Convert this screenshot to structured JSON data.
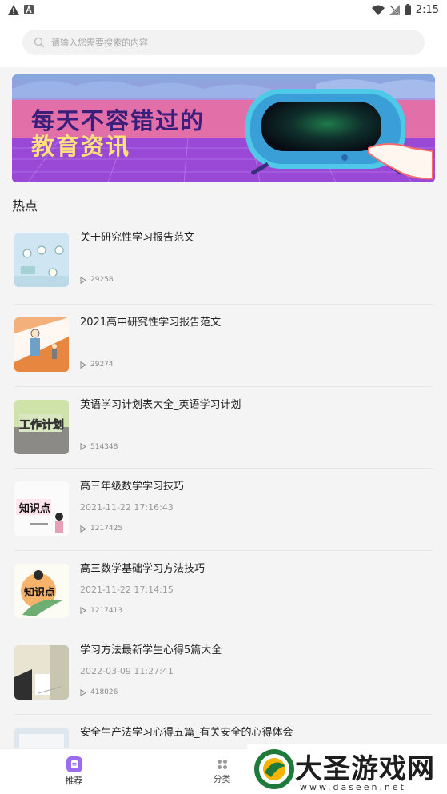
{
  "status_bar": {
    "time": "2:15",
    "left_icons": [
      "warning-icon",
      "a-icon"
    ],
    "right_icons": [
      "wifi-icon",
      "no-signal-icon",
      "battery-icon"
    ]
  },
  "search": {
    "placeholder": "请输入您需要搜索的内容"
  },
  "banner": {
    "line1": "每天不容错过的",
    "line2": "教育资讯",
    "colors": {
      "sky": "#7ea6dc",
      "floor": "#9f4fd8",
      "pink": "#e96fa8",
      "screen": "#4cc7e6"
    }
  },
  "section": {
    "title": "热点"
  },
  "articles": [
    {
      "title": "关于研究性学习报告范文",
      "date": "",
      "views": "29258"
    },
    {
      "title": "2021高中研究性学习报告范文",
      "date": "",
      "views": "29274"
    },
    {
      "title": "英语学习计划表大全_英语学习计划",
      "date": "",
      "views": "514348"
    },
    {
      "title": "高三年级数学学习技巧",
      "date": "2021-11-22 17:16:43",
      "views": "1217425"
    },
    {
      "title": "高三数学基础学习方法技巧",
      "date": "2021-11-22 17:14:15",
      "views": "1217413"
    },
    {
      "title": "学习方法最新学生心得5篇大全",
      "date": "2022-03-09 11:27:41",
      "views": "418026"
    },
    {
      "title": "安全生产法学习心得五篇_有关安全的心得体会",
      "date": "",
      "views": ""
    }
  ],
  "thumbs": {
    "t3": "工作计划",
    "t4": "知识点",
    "t5": "知识点"
  },
  "tabs": [
    {
      "label": "推荐",
      "icon": "recommend-icon",
      "active": true
    },
    {
      "label": "分类",
      "icon": "category-icon",
      "active": false
    }
  ],
  "watermark": {
    "text": "大圣游戏网",
    "url": "www.daseen.net"
  }
}
